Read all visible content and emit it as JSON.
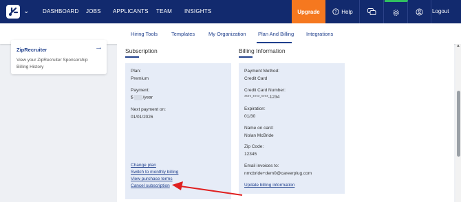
{
  "topnav": {
    "items": [
      "DASHBOARD",
      "JOBS",
      "APPLICANTS",
      "TEAM",
      "INSIGHTS"
    ],
    "upgrade_label": "Upgrade",
    "help_label": "Help",
    "logout_label": "Logout",
    "brand_color": "#122a6e",
    "upgrade_color": "#f5781f"
  },
  "subnav": {
    "items": [
      "Hiring Tools",
      "Templates",
      "My Organization",
      "Plan And Billing",
      "Integrations"
    ],
    "active": "Plan And Billing"
  },
  "sidebar_card": {
    "title": "ZipRecruiter",
    "text": "View your ZipRecruiter Sponsorship Billing History"
  },
  "subscription": {
    "title": "Subscription",
    "plan_label": "Plan:",
    "plan_value": "Premium",
    "payment_label": "Payment:",
    "payment_prefix": "$",
    "payment_suffix": "/year",
    "next_label": "Next payment on:",
    "next_value": "01/01/2026",
    "links": [
      "Change plan",
      "Switch to monthly billing",
      "View purchase terms",
      "Cancel subscription"
    ]
  },
  "billing": {
    "title": "Billing Information",
    "method_label": "Payment Method:",
    "method_value": "Credit Card",
    "card_label": "Credit Card Number:",
    "card_value": "****-****-****-1234",
    "exp_label": "Expiration:",
    "exp_value": "01/30",
    "name_label": "Name on card:",
    "name_value": "Nolan McBride",
    "zip_label": "Zip Code:",
    "zip_value": "12345",
    "email_label": "Email invoices to:",
    "email_value": "nmcbride+dem0@careerplug.com",
    "update_link": "Update billing information"
  },
  "annotation": {
    "color": "#e02020",
    "target": "Cancel subscription"
  }
}
